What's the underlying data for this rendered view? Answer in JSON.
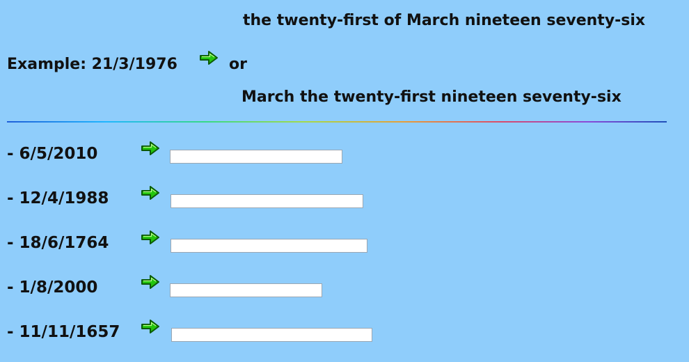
{
  "example": {
    "line1": "the twenty-first of March nineteen seventy-six",
    "prefix": "Example: 21/3/1976",
    "or": "or",
    "line2": "March the twenty-first nineteen seventy-six"
  },
  "icons": {
    "arrow": "green-arrow-right-icon"
  },
  "exercises": [
    {
      "label": "- 6/5/2010",
      "value": ""
    },
    {
      "label": "- 12/4/1988",
      "value": ""
    },
    {
      "label": "- 18/6/1764",
      "value": ""
    },
    {
      "label": "- 1/8/2000",
      "value": ""
    },
    {
      "label": "- 11/11/1657",
      "value": ""
    }
  ]
}
